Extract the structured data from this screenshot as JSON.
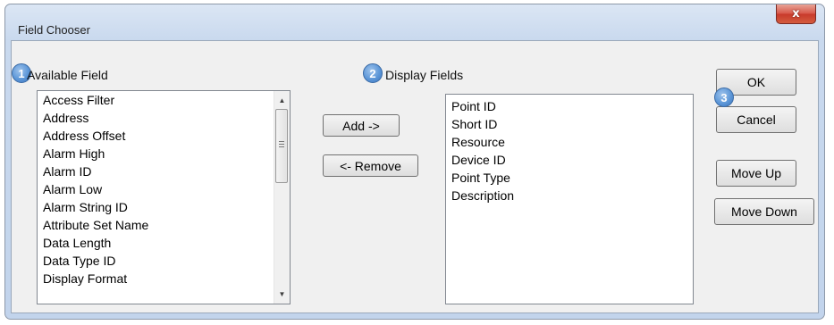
{
  "window": {
    "title": "Field Chooser",
    "close_label": "x"
  },
  "available": {
    "badge": "1",
    "label": "Available Field",
    "items": [
      "Access Filter",
      "Address",
      "Address Offset",
      "Alarm High",
      "Alarm ID",
      "Alarm Low",
      "Alarm String ID",
      "Attribute Set Name",
      "Data Length",
      "Data Type ID",
      "Display Format"
    ]
  },
  "display": {
    "badge": "2",
    "label": "Display Fields",
    "items": [
      "Point ID",
      "Short ID",
      "Resource",
      "Device ID",
      "Point Type",
      "Description"
    ]
  },
  "buttons": {
    "add": "Add ->",
    "remove": "<- Remove",
    "ok": "OK",
    "cancel": "Cancel",
    "move_up": "Move Up",
    "move_down": "Move Down"
  },
  "actions_badge": "3",
  "icons": {
    "close": "close-icon",
    "scroll_up": "scroll-up-arrow-icon",
    "scroll_down": "scroll-down-arrow-icon",
    "badge_shape": "circle-number-badge"
  }
}
